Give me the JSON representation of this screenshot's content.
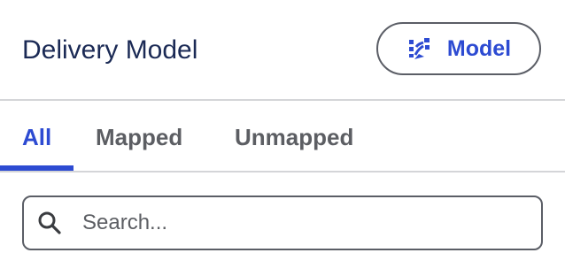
{
  "header": {
    "title": "Delivery Model",
    "model_button_label": "Model",
    "model_button_icon": "swap-arrows-icon"
  },
  "tabs": [
    {
      "label": "All",
      "active": true
    },
    {
      "label": "Mapped",
      "active": false
    },
    {
      "label": "Unmapped",
      "active": false
    }
  ],
  "search": {
    "placeholder": "Search...",
    "value": "",
    "icon": "search-icon"
  },
  "colors": {
    "accent": "#2d4bd2",
    "title": "#1b2a55",
    "tab_inactive": "#5c5e63",
    "border": "#5b5e66",
    "divider": "#d4d5d8"
  }
}
